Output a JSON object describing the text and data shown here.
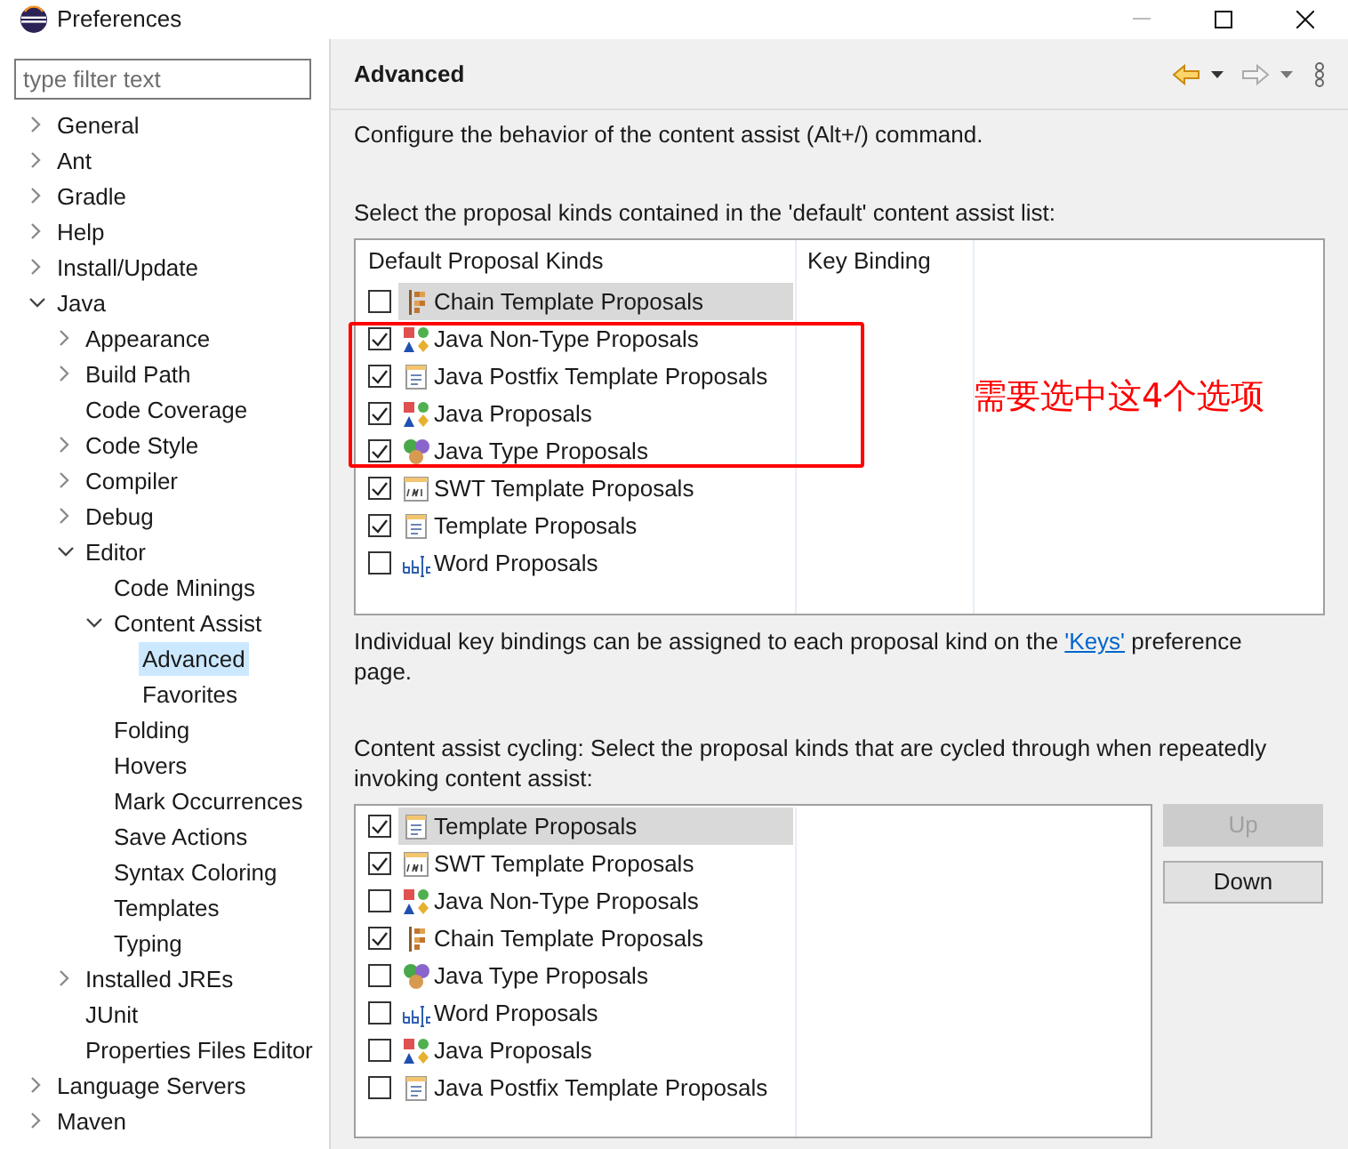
{
  "window": {
    "title": "Preferences"
  },
  "filter": {
    "placeholder": "type filter text"
  },
  "tree": [
    {
      "label": "General",
      "expanded": false,
      "selected": false
    },
    {
      "label": "Ant",
      "expanded": false,
      "selected": false
    },
    {
      "label": "Gradle",
      "expanded": false,
      "selected": false
    },
    {
      "label": "Help",
      "expanded": false,
      "selected": false
    },
    {
      "label": "Install/Update",
      "expanded": false,
      "selected": false
    },
    {
      "label": "Java",
      "expanded": true,
      "selected": false,
      "children": [
        {
          "label": "Appearance",
          "expanded": false,
          "selected": false
        },
        {
          "label": "Build Path",
          "expanded": false,
          "selected": false
        },
        {
          "label": "Code Coverage",
          "selected": false
        },
        {
          "label": "Code Style",
          "expanded": false,
          "selected": false
        },
        {
          "label": "Compiler",
          "expanded": false,
          "selected": false
        },
        {
          "label": "Debug",
          "expanded": false,
          "selected": false
        },
        {
          "label": "Editor",
          "expanded": true,
          "selected": false,
          "children": [
            {
              "label": "Code Minings",
              "selected": false
            },
            {
              "label": "Content Assist",
              "expanded": true,
              "selected": false,
              "children": [
                {
                  "label": "Advanced",
                  "selected": true
                },
                {
                  "label": "Favorites",
                  "selected": false
                }
              ]
            },
            {
              "label": "Folding",
              "selected": false
            },
            {
              "label": "Hovers",
              "selected": false
            },
            {
              "label": "Mark Occurrences",
              "selected": false
            },
            {
              "label": "Save Actions",
              "selected": false
            },
            {
              "label": "Syntax Coloring",
              "selected": false
            },
            {
              "label": "Templates",
              "selected": false
            },
            {
              "label": "Typing",
              "selected": false
            }
          ]
        },
        {
          "label": "Installed JREs",
          "expanded": false,
          "selected": false
        },
        {
          "label": "JUnit",
          "selected": false
        },
        {
          "label": "Properties Files Editor",
          "selected": false
        }
      ]
    },
    {
      "label": "Language Servers",
      "expanded": false,
      "selected": false
    },
    {
      "label": "Maven",
      "expanded": false,
      "selected": false
    }
  ],
  "page": {
    "title": "Advanced",
    "description": "Configure the behavior of the content assist (Alt+/) command.",
    "default_list_label": "Select the proposal kinds contained in the 'default' content assist list:",
    "default_table": {
      "columns": [
        "Default Proposal Kinds",
        "Key Binding"
      ],
      "rows": [
        {
          "label": "Chain Template Proposals",
          "kind": "chain",
          "checked": false,
          "selected": true
        },
        {
          "label": "Java Non-Type Proposals",
          "kind": "java",
          "checked": true,
          "selected": false
        },
        {
          "label": "Java Postfix Template Proposals",
          "kind": "template",
          "checked": true,
          "selected": false
        },
        {
          "label": "Java Proposals",
          "kind": "java",
          "checked": true,
          "selected": false
        },
        {
          "label": "Java Type Proposals",
          "kind": "type",
          "checked": true,
          "selected": false
        },
        {
          "label": "SWT Template Proposals",
          "kind": "swt",
          "checked": true,
          "selected": false
        },
        {
          "label": "Template Proposals",
          "kind": "template",
          "checked": true,
          "selected": false
        },
        {
          "label": "Word Proposals",
          "kind": "word",
          "checked": false,
          "selected": false
        }
      ]
    },
    "keys_note": {
      "before": "Individual key bindings can be assigned to each proposal kind on the",
      "link": "'Keys'",
      "after": "preference page."
    },
    "cycling_label": "Content assist cycling: Select the proposal kinds that are cycled through when repeatedly invoking content assist:",
    "cycling_list": [
      {
        "label": "Template Proposals",
        "kind": "template",
        "checked": true,
        "selected": true
      },
      {
        "label": "SWT Template Proposals",
        "kind": "swt",
        "checked": true,
        "selected": false
      },
      {
        "label": "Java Non-Type Proposals",
        "kind": "java",
        "checked": false,
        "selected": false
      },
      {
        "label": "Chain Template Proposals",
        "kind": "chain",
        "checked": true,
        "selected": false
      },
      {
        "label": "Java Type Proposals",
        "kind": "type",
        "checked": false,
        "selected": false
      },
      {
        "label": "Word Proposals",
        "kind": "word",
        "checked": false,
        "selected": false
      },
      {
        "label": "Java Proposals",
        "kind": "java",
        "checked": false,
        "selected": false
      },
      {
        "label": "Java Postfix Template Proposals",
        "kind": "template",
        "checked": false,
        "selected": false
      }
    ],
    "buttons": [
      {
        "label": "Up",
        "disabled": true
      },
      {
        "label": "Down",
        "disabled": false
      }
    ]
  },
  "annotation": {
    "text": "需要选中这4个选项",
    "color": "#ff0000"
  }
}
